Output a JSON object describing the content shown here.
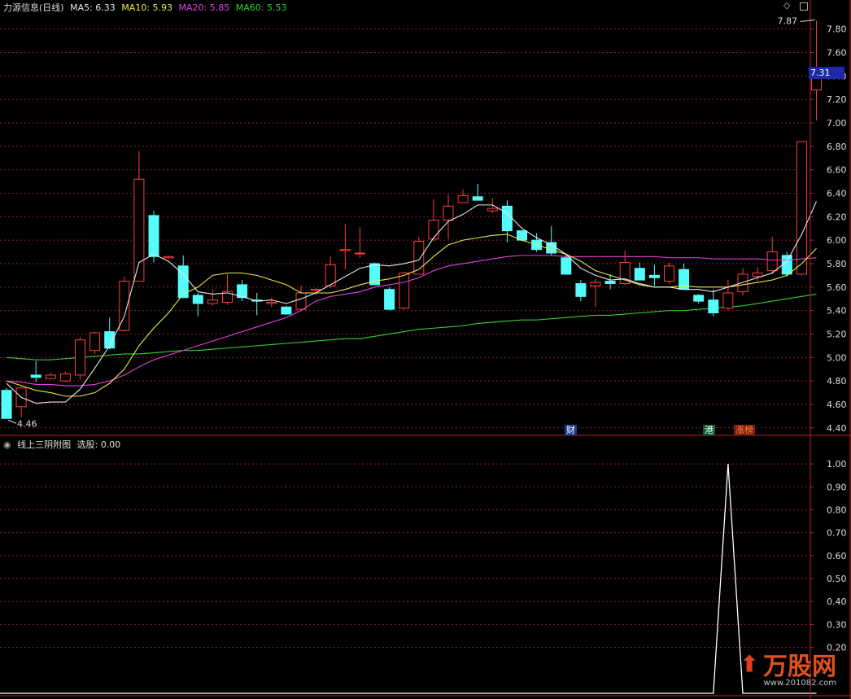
{
  "upper_panel": {
    "stock_title": "力源信息(日线)",
    "ma_legend": [
      {
        "label": "MA5: 6.33",
        "color": "#e8e8e8"
      },
      {
        "label": "MA10: 5.93",
        "color": "#e8e84a"
      },
      {
        "label": "MA20: 5.85",
        "color": "#e040e0"
      },
      {
        "label": "MA60: 5.53",
        "color": "#30d030"
      }
    ],
    "y_ticks": [
      "7.80",
      "7.60",
      "7.40",
      "7.20",
      "7.00",
      "6.80",
      "6.60",
      "6.40",
      "6.20",
      "6.00",
      "5.80",
      "5.60",
      "5.40",
      "5.20",
      "5.00",
      "4.80",
      "4.60",
      "4.40"
    ],
    "current_price": "7.31",
    "high_label": "7.87",
    "low_label": "4.46",
    "badges": [
      {
        "text": "财",
        "bg": "#1d3d8a",
        "color": "#fff"
      },
      {
        "text": "港",
        "bg": "#0c5d34",
        "color": "#fff"
      },
      {
        "text": "涨榜",
        "bg": "#7a1a14",
        "color": "#ff8a3a"
      }
    ]
  },
  "lower_panel": {
    "title": "线上三阴附图",
    "select_label": "选股: 0.00",
    "y_ticks": [
      "1.00",
      "0.90",
      "0.80",
      "0.70",
      "0.60",
      "0.50",
      "0.40",
      "0.30",
      "0.20"
    ]
  },
  "watermark": {
    "text": "万股网",
    "url": "www.201082.com"
  },
  "colors": {
    "up": "#ff3c3c",
    "down": "#54fcfc",
    "grid": "#8a1f1f",
    "axis": "#c02020"
  },
  "chart_data": {
    "type": "candlestick",
    "ylim": [
      4.35,
      7.95
    ],
    "candles": [
      [
        4.72,
        4.74,
        4.48,
        4.48
      ],
      [
        4.58,
        4.75,
        4.49,
        4.74
      ],
      [
        4.85,
        4.97,
        4.79,
        4.83
      ],
      [
        4.82,
        4.87,
        4.81,
        4.85
      ],
      [
        4.8,
        4.88,
        4.79,
        4.86
      ],
      [
        4.85,
        5.17,
        4.81,
        5.15
      ],
      [
        5.06,
        5.22,
        5.03,
        5.21
      ],
      [
        5.22,
        5.34,
        5.07,
        5.08
      ],
      [
        5.23,
        5.69,
        5.22,
        5.65
      ],
      [
        5.65,
        6.76,
        5.65,
        6.52
      ],
      [
        6.21,
        6.25,
        5.81,
        5.86
      ],
      [
        5.85,
        5.87,
        5.84,
        5.86
      ],
      [
        5.78,
        5.87,
        5.52,
        5.51
      ],
      [
        5.53,
        5.55,
        5.35,
        5.46
      ],
      [
        5.46,
        5.58,
        5.44,
        5.49
      ],
      [
        5.47,
        5.71,
        5.45,
        5.56
      ],
      [
        5.62,
        5.66,
        5.48,
        5.51
      ],
      [
        5.49,
        5.55,
        5.36,
        5.48
      ],
      [
        5.46,
        5.51,
        5.43,
        5.47
      ],
      [
        5.43,
        5.44,
        5.38,
        5.37
      ],
      [
        5.41,
        5.61,
        5.4,
        5.55
      ],
      [
        5.58,
        5.59,
        5.53,
        5.58
      ],
      [
        5.61,
        5.86,
        5.59,
        5.79
      ],
      [
        5.91,
        6.14,
        5.75,
        5.92
      ],
      [
        5.89,
        6.11,
        5.85,
        5.89
      ],
      [
        5.8,
        5.81,
        5.62,
        5.62
      ],
      [
        5.58,
        5.6,
        5.4,
        5.41
      ],
      [
        5.42,
        5.73,
        5.41,
        5.72
      ],
      [
        5.71,
        6.03,
        5.73,
        5.99
      ],
      [
        6.01,
        6.35,
        5.99,
        6.17
      ],
      [
        6.17,
        6.39,
        6.01,
        6.29
      ],
      [
        6.32,
        6.43,
        6.32,
        6.38
      ],
      [
        6.37,
        6.48,
        6.34,
        6.34
      ],
      [
        6.25,
        6.36,
        6.23,
        6.27
      ],
      [
        6.29,
        6.34,
        5.98,
        6.08
      ],
      [
        6.08,
        6.07,
        5.99,
        6.0
      ],
      [
        6.0,
        6.06,
        5.9,
        5.92
      ],
      [
        5.98,
        6.12,
        5.87,
        5.89
      ],
      [
        5.85,
        5.88,
        5.73,
        5.71
      ],
      [
        5.63,
        5.66,
        5.48,
        5.52
      ],
      [
        5.61,
        5.67,
        5.43,
        5.64
      ],
      [
        5.65,
        5.71,
        5.58,
        5.63
      ],
      [
        5.63,
        5.91,
        5.62,
        5.81
      ],
      [
        5.76,
        5.81,
        5.69,
        5.66
      ],
      [
        5.7,
        5.79,
        5.61,
        5.68
      ],
      [
        5.65,
        5.81,
        5.63,
        5.78
      ],
      [
        5.75,
        5.8,
        5.59,
        5.58
      ],
      [
        5.53,
        5.54,
        5.46,
        5.48
      ],
      [
        5.49,
        5.58,
        5.35,
        5.38
      ],
      [
        5.42,
        5.66,
        5.4,
        5.55
      ],
      [
        5.56,
        5.76,
        5.53,
        5.71
      ],
      [
        5.69,
        5.77,
        5.65,
        5.72
      ],
      [
        5.74,
        6.03,
        5.71,
        5.9
      ],
      [
        5.87,
        5.9,
        5.69,
        5.71
      ],
      [
        5.71,
        6.84,
        5.7,
        6.84
      ],
      [
        7.28,
        7.87,
        7.02,
        7.39
      ]
    ],
    "ma5": [
      4.78,
      4.66,
      4.61,
      4.62,
      4.62,
      4.73,
      4.91,
      5.1,
      5.35,
      5.81,
      5.88,
      5.82,
      5.71,
      5.56,
      5.54,
      5.55,
      5.52,
      5.48,
      5.49,
      5.46,
      5.5,
      5.55,
      5.62,
      5.69,
      5.76,
      5.79,
      5.78,
      5.8,
      5.83,
      6.02,
      6.16,
      6.22,
      6.3,
      6.3,
      6.23,
      6.1,
      6.02,
      5.96,
      5.88,
      5.76,
      5.7,
      5.66,
      5.67,
      5.63,
      5.6,
      5.6,
      5.58,
      5.58,
      5.56,
      5.6,
      5.64,
      5.68,
      5.72,
      5.82,
      6.05,
      6.33
    ],
    "ma10": [
      4.8,
      4.76,
      4.72,
      4.7,
      4.67,
      4.67,
      4.7,
      4.78,
      4.9,
      5.1,
      5.25,
      5.38,
      5.54,
      5.6,
      5.7,
      5.72,
      5.72,
      5.7,
      5.66,
      5.62,
      5.55,
      5.55,
      5.55,
      5.58,
      5.62,
      5.65,
      5.67,
      5.7,
      5.75,
      5.86,
      5.96,
      6.0,
      6.02,
      6.04,
      6.05,
      6.0,
      5.96,
      5.92,
      5.88,
      5.82,
      5.74,
      5.7,
      5.66,
      5.62,
      5.6,
      5.6,
      5.61,
      5.6,
      5.6,
      5.6,
      5.62,
      5.64,
      5.66,
      5.7,
      5.8,
      5.93
    ],
    "ma20": [
      4.8,
      4.79,
      4.77,
      4.77,
      4.76,
      4.76,
      4.77,
      4.8,
      4.85,
      4.92,
      4.98,
      5.02,
      5.06,
      5.1,
      5.14,
      5.18,
      5.22,
      5.26,
      5.3,
      5.34,
      5.4,
      5.48,
      5.52,
      5.54,
      5.56,
      5.6,
      5.62,
      5.64,
      5.68,
      5.74,
      5.78,
      5.8,
      5.82,
      5.84,
      5.86,
      5.87,
      5.87,
      5.87,
      5.86,
      5.86,
      5.86,
      5.86,
      5.86,
      5.86,
      5.86,
      5.85,
      5.85,
      5.85,
      5.84,
      5.84,
      5.84,
      5.84,
      5.83,
      5.83,
      5.84,
      5.85
    ],
    "ma60": [
      5.0,
      4.99,
      4.98,
      4.98,
      4.99,
      5.0,
      5.01,
      5.02,
      5.03,
      5.03,
      5.04,
      5.05,
      5.06,
      5.06,
      5.07,
      5.08,
      5.09,
      5.1,
      5.11,
      5.12,
      5.13,
      5.14,
      5.15,
      5.16,
      5.16,
      5.18,
      5.2,
      5.22,
      5.24,
      5.25,
      5.26,
      5.27,
      5.29,
      5.3,
      5.31,
      5.32,
      5.32,
      5.33,
      5.34,
      5.35,
      5.36,
      5.36,
      5.37,
      5.38,
      5.39,
      5.4,
      5.4,
      5.41,
      5.42,
      5.43,
      5.44,
      5.46,
      5.48,
      5.5,
      5.52,
      5.54
    ],
    "indicator": {
      "ylim": [
        0,
        1.05
      ],
      "values": [
        0,
        0,
        0,
        0,
        0,
        0,
        0,
        0,
        0,
        0,
        0,
        0,
        0,
        0,
        0,
        0,
        0,
        0,
        0,
        0,
        0,
        0,
        0,
        0,
        0,
        0,
        0,
        0,
        0,
        0,
        0,
        0,
        0,
        0,
        0,
        0,
        0,
        0,
        0,
        0,
        0,
        0,
        0,
        0,
        0,
        0,
        0,
        0,
        0,
        1,
        0,
        0,
        0,
        0,
        0,
        0
      ]
    }
  }
}
